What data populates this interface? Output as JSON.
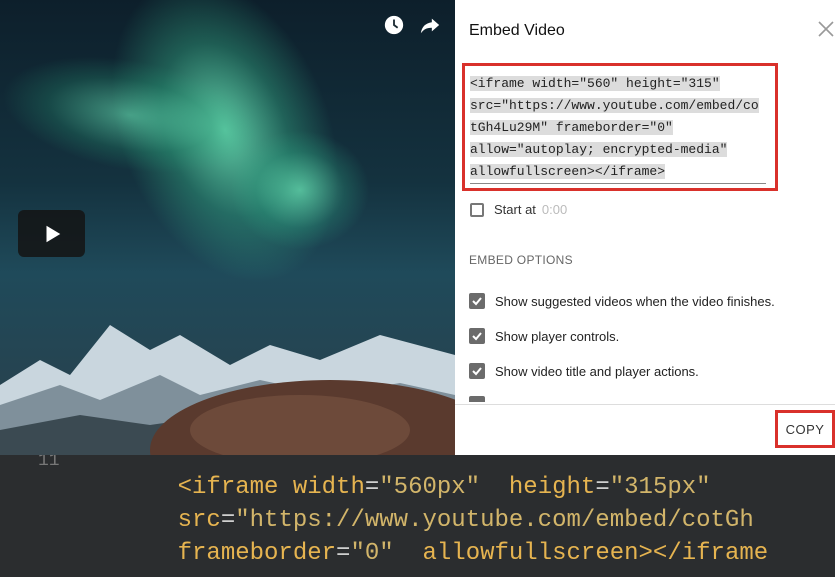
{
  "embed": {
    "title": "Embed Video",
    "code_lines": [
      "<iframe width=\"560\" height=\"315\"",
      "src=\"https://www.youtube.com/embed/co",
      "tGh4Lu29M\" frameborder=\"0\"",
      "allow=\"autoplay; encrypted-media\"",
      "allowfullscreen></iframe>"
    ],
    "start_at_label": "Start at",
    "start_at_time": "0:00",
    "options_heading": "EMBED OPTIONS",
    "options": [
      {
        "label": "Show suggested videos when the video finishes.",
        "checked": true
      },
      {
        "label": "Show player controls.",
        "checked": true
      },
      {
        "label": "Show video title and player actions.",
        "checked": true
      }
    ],
    "copy_label": "COPY"
  },
  "code_snippet": {
    "line_number": "11",
    "line1": {
      "tag": "<iframe",
      "attr1": "width",
      "val1": "\"560px\"",
      "attr2": "height",
      "val2": "\"315px\""
    },
    "line2": {
      "attr": "src",
      "val": "\"https://www.youtube.com/embed/cotGh"
    },
    "line3": {
      "attr1": "frameborder",
      "val1": "\"0\"",
      "attr2": "allowfullscreen",
      "tail": "></iframe"
    }
  },
  "colors": {
    "highlight_red": "#d9312b",
    "code_bg": "#2b2d2f",
    "code_yellow": "#e6b450"
  }
}
